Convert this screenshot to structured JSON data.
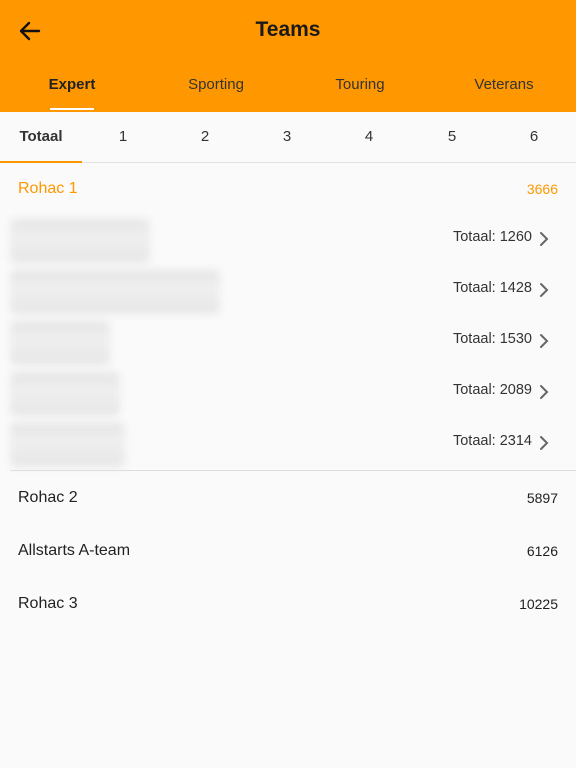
{
  "header": {
    "title": "Teams",
    "back_icon": "arrow-left-icon"
  },
  "category_tabs": [
    {
      "label": "Expert",
      "active": true
    },
    {
      "label": "Sporting",
      "active": false
    },
    {
      "label": "Touring",
      "active": false
    },
    {
      "label": "Veterans",
      "active": false
    }
  ],
  "round_tabs": [
    {
      "label": "Totaal",
      "active": true
    },
    {
      "label": "1"
    },
    {
      "label": "2"
    },
    {
      "label": "3"
    },
    {
      "label": "4"
    },
    {
      "label": "5"
    },
    {
      "label": "6"
    }
  ],
  "expanded_team": {
    "name": "Rohac 1",
    "score": "3666",
    "members": [
      {
        "total": "Totaal: 1260"
      },
      {
        "total": "Totaal: 1428"
      },
      {
        "total": "Totaal: 1530"
      },
      {
        "total": "Totaal: 2089"
      },
      {
        "total": "Totaal: 2314"
      }
    ]
  },
  "teams": [
    {
      "name": "Rohac 2",
      "score": "5897"
    },
    {
      "name": "Allstarts A-team",
      "score": "6126"
    },
    {
      "name": "Rohac 3",
      "score": "10225"
    }
  ],
  "colors": {
    "accent": "#ff9800",
    "background": "#fafafa"
  }
}
